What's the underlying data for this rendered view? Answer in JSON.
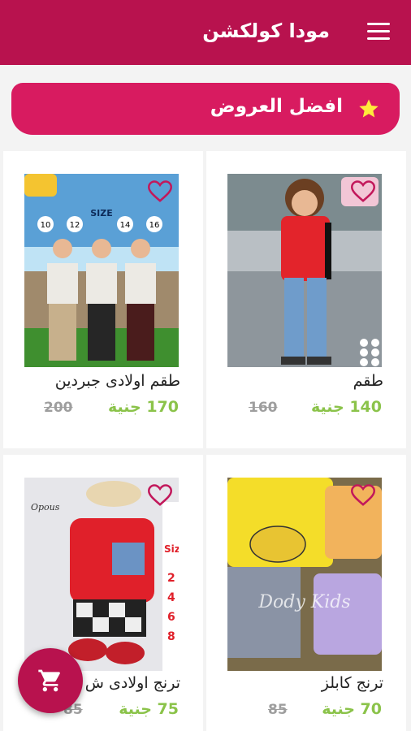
{
  "app": {
    "title": "مودا كولكشن"
  },
  "offers": {
    "label": "افضل العروض"
  },
  "products": [
    {
      "name": "طقم",
      "price": "140 جنية",
      "old_price": "160"
    },
    {
      "name": "طقم اولادى جبردين",
      "price": "170 جنية",
      "old_price": "200"
    },
    {
      "name": "ترنج كابلز",
      "price": "70 جنية",
      "old_price": "85"
    },
    {
      "name": "ترنج اولادى ش",
      "price": "75 جنية",
      "old_price": "85"
    }
  ],
  "product_images": [
    {
      "label_text": "",
      "sizes": []
    },
    {
      "label_text": "SIZE",
      "sizes": [
        "10",
        "12",
        "14",
        "16"
      ]
    },
    {
      "label_text": "Dody Kids",
      "sizes": []
    },
    {
      "label_text": "Opous",
      "sizes": [
        "Siz",
        "2",
        "4",
        "6",
        "8"
      ]
    }
  ],
  "colors": {
    "primary": "#b8124e",
    "banner": "#d81b60",
    "price": "#8bc34a",
    "star": "#ffeb3b"
  }
}
